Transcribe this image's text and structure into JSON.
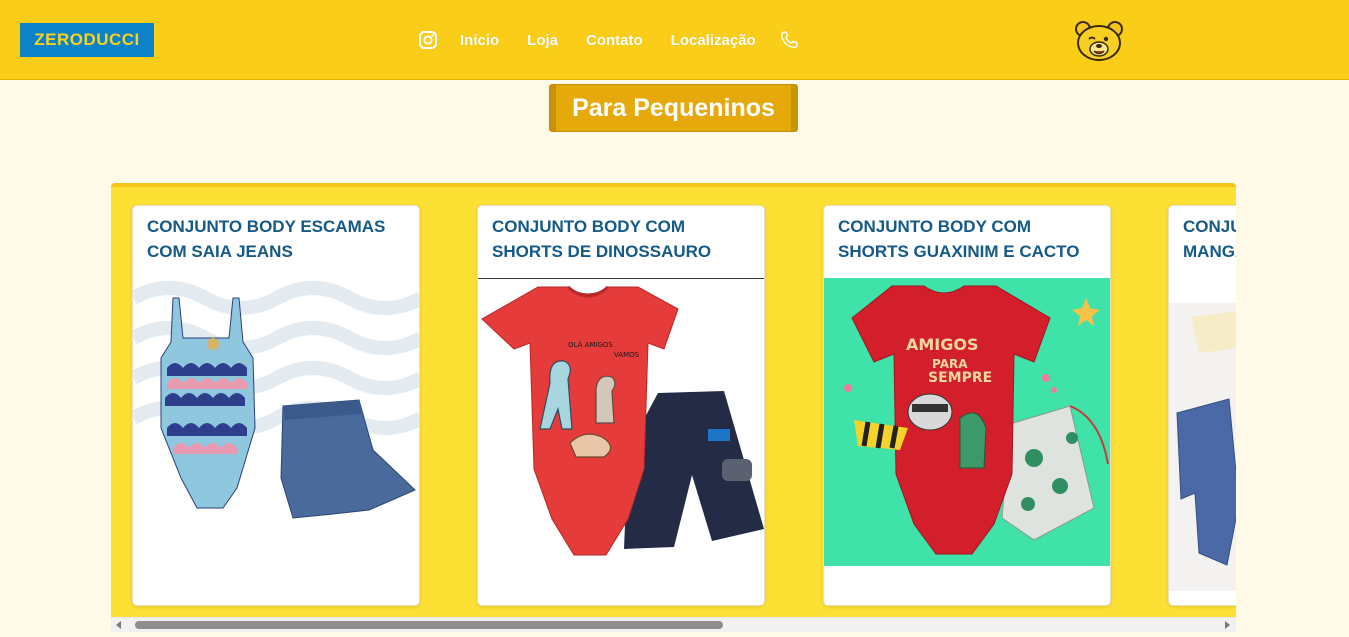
{
  "brand": {
    "logo_text": "ZERODUCCI",
    "logo_bg": "#0c83c9",
    "logo_fg": "#f9d21e"
  },
  "header": {
    "bg": "#f9cd18",
    "mascot_icon": "bear-icon"
  },
  "nav": {
    "instagram_icon": "instagram-icon",
    "items": [
      "Início",
      "Loja",
      "Contato",
      "Localização"
    ],
    "phone_icon": "phone-icon"
  },
  "section": {
    "title": "Para Pequeninos"
  },
  "products": [
    {
      "title": "CONJUNTO BODY ESCAMAS COM SAIA JEANS"
    },
    {
      "title": "CONJUNTO BODY COM SHORTS DE DINOSSAURO"
    },
    {
      "title": "CONJUNTO BODY COM SHORTS GUAXINIM E CACTO"
    },
    {
      "title": "CONJUNTO BODY COM MANGAS E CALÇA"
    }
  ],
  "scroll": {
    "position": 0.0
  }
}
